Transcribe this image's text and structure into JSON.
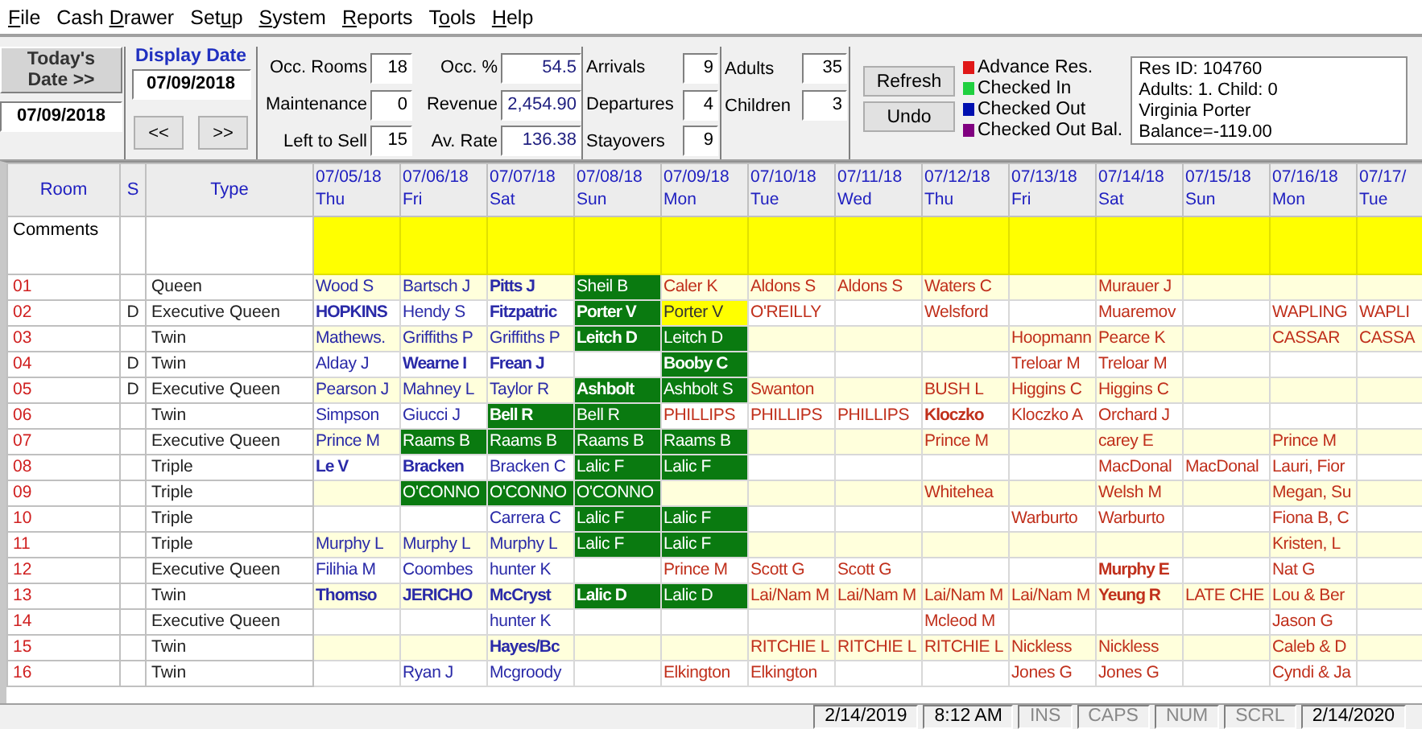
{
  "menu": [
    {
      "key": "F",
      "post": "ile"
    },
    {
      "pre": "Cash ",
      "key": "D",
      "post": "rawer"
    },
    {
      "pre": "Set",
      "key": "u",
      "post": "p"
    },
    {
      "key": "S",
      "post": "ystem"
    },
    {
      "key": "R",
      "post": "eports"
    },
    {
      "pre": "T",
      "key": "o",
      "post": "ols"
    },
    {
      "key": "H",
      "post": "elp"
    }
  ],
  "today": {
    "button": "Today's Date >>",
    "value": "07/09/2018"
  },
  "display_date": {
    "label": "Display Date",
    "value": "07/09/2018",
    "prev": "<<",
    "next": ">>"
  },
  "stat_groups": [
    [
      {
        "label": "Occ. Rooms",
        "value": "18"
      },
      {
        "label": "Maintenance",
        "value": "0"
      },
      {
        "label": "Left to Sell",
        "value": "15"
      }
    ],
    [
      {
        "label": "Occ. %",
        "value": "54.5"
      },
      {
        "label": "Revenue",
        "value": "2,454.90"
      },
      {
        "label": "Av. Rate",
        "value": "136.38"
      }
    ],
    [
      {
        "label": "Arrivals",
        "value": "9"
      },
      {
        "label": "Departures",
        "value": "4"
      },
      {
        "label": "Stayovers",
        "value": "9"
      }
    ],
    [
      {
        "label": "Adults",
        "value": "35"
      },
      {
        "label": "Children",
        "value": "3"
      }
    ]
  ],
  "buttons": [
    "Refresh",
    "Undo"
  ],
  "legend": [
    {
      "label": "Advance Res.",
      "color": "#e01818"
    },
    {
      "label": "Checked In",
      "color": "#20d040"
    },
    {
      "label": "Checked Out",
      "color": "#0010b0"
    },
    {
      "label": "Checked Out Bal.",
      "color": "#800080"
    }
  ],
  "res_info": [
    "Res ID: 104760",
    "Adults: 1. Child: 0",
    "Virginia Porter",
    "Balance=-119.00"
  ],
  "grid": {
    "room_header": "Room",
    "s_header": "S",
    "type_header": "Type",
    "comments_label": "Comments",
    "dates": [
      {
        "date": "07/05/18",
        "day": "Thu"
      },
      {
        "date": "07/06/18",
        "day": "Fri"
      },
      {
        "date": "07/07/18",
        "day": "Sat"
      },
      {
        "date": "07/08/18",
        "day": "Sun"
      },
      {
        "date": "07/09/18",
        "day": "Mon"
      },
      {
        "date": "07/10/18",
        "day": "Tue"
      },
      {
        "date": "07/11/18",
        "day": "Wed"
      },
      {
        "date": "07/12/18",
        "day": "Thu"
      },
      {
        "date": "07/13/18",
        "day": "Fri"
      },
      {
        "date": "07/14/18",
        "day": "Sat"
      },
      {
        "date": "07/15/18",
        "day": "Sun"
      },
      {
        "date": "07/16/18",
        "day": "Mon"
      },
      {
        "date": "07/17/",
        "day": "Tue"
      }
    ],
    "rows": [
      {
        "room": "01",
        "s": null,
        "type": "Queen",
        "cells": [
          {
            "text": "Wood S",
            "kind": "checked_out",
            "bold": false
          },
          {
            "text": "Bartsch J",
            "kind": "checked_out",
            "bold": false
          },
          {
            "text": "Pitts J",
            "kind": "checked_out",
            "bold": true
          },
          {
            "text": "Sheil B",
            "kind": "checked_in",
            "bold": false
          },
          {
            "text": "Caler K",
            "kind": "advance",
            "bold": false
          },
          {
            "text": "Aldons S",
            "kind": "advance",
            "bold": false
          },
          {
            "text": "Aldons S",
            "kind": "advance",
            "bold": false
          },
          {
            "text": "Waters C",
            "kind": "advance",
            "bold": false
          },
          null,
          {
            "text": "Murauer J",
            "kind": "advance",
            "bold": false
          },
          null,
          null,
          null
        ]
      },
      {
        "room": "02",
        "s": "D",
        "type": "Executive Queen",
        "cells": [
          {
            "text": "HOPKINS",
            "kind": "checked_out",
            "bold": true
          },
          {
            "text": "Hendy S",
            "kind": "checked_out",
            "bold": false
          },
          {
            "text": "Fitzpatric",
            "kind": "checked_out",
            "bold": true
          },
          {
            "text": "Porter V",
            "kind": "checked_in",
            "bold": true
          },
          {
            "text": "Porter V",
            "kind": "current",
            "bold": false
          },
          {
            "text": "O'REILLY",
            "kind": "advance",
            "bold": false
          },
          null,
          {
            "text": "Welsford",
            "kind": "advance",
            "bold": false
          },
          null,
          {
            "text": "Muaremov",
            "kind": "advance",
            "bold": false
          },
          null,
          {
            "text": "WAPLING",
            "kind": "advance",
            "bold": false
          },
          {
            "text": "WAPLI",
            "kind": "advance",
            "bold": false
          }
        ]
      },
      {
        "room": "03",
        "s": null,
        "type": "Twin",
        "cells": [
          {
            "text": "Mathews.",
            "kind": "checked_out",
            "bold": false
          },
          {
            "text": "Griffiths P",
            "kind": "checked_out",
            "bold": false
          },
          {
            "text": "Griffiths P",
            "kind": "checked_out",
            "bold": false
          },
          {
            "text": "Leitch D",
            "kind": "checked_in",
            "bold": true
          },
          {
            "text": "Leitch D",
            "kind": "checked_in",
            "bold": false
          },
          null,
          null,
          null,
          {
            "text": "Hoopmann",
            "kind": "advance",
            "bold": false
          },
          {
            "text": "Pearce K",
            "kind": "advance",
            "bold": false
          },
          null,
          {
            "text": "CASSAR",
            "kind": "advance",
            "bold": false
          },
          {
            "text": "CASSA",
            "kind": "advance",
            "bold": false
          }
        ]
      },
      {
        "room": "04",
        "s": "D",
        "type": "Twin",
        "cells": [
          {
            "text": "Alday J",
            "kind": "checked_out",
            "bold": false
          },
          {
            "text": "Wearne I",
            "kind": "checked_out",
            "bold": true
          },
          {
            "text": "Frean J",
            "kind": "checked_out",
            "bold": true
          },
          null,
          {
            "text": "Booby C",
            "kind": "checked_in",
            "bold": true
          },
          null,
          null,
          null,
          {
            "text": "Treloar M",
            "kind": "advance",
            "bold": false
          },
          {
            "text": "Treloar M",
            "kind": "advance",
            "bold": false
          },
          null,
          null,
          null
        ]
      },
      {
        "room": "05",
        "s": "D",
        "type": "Executive Queen",
        "cells": [
          {
            "text": "Pearson J",
            "kind": "checked_out",
            "bold": false
          },
          {
            "text": "Mahney L",
            "kind": "checked_out",
            "bold": false
          },
          {
            "text": "Taylor R",
            "kind": "checked_out",
            "bold": false
          },
          {
            "text": "Ashbolt",
            "kind": "checked_in",
            "bold": true
          },
          {
            "text": "Ashbolt S",
            "kind": "checked_in",
            "bold": false
          },
          {
            "text": "Swanton",
            "kind": "advance",
            "bold": false
          },
          null,
          {
            "text": "BUSH L",
            "kind": "advance",
            "bold": false
          },
          {
            "text": "Higgins C",
            "kind": "advance",
            "bold": false
          },
          {
            "text": "Higgins C",
            "kind": "advance",
            "bold": false
          },
          null,
          null,
          null
        ]
      },
      {
        "room": "06",
        "s": null,
        "type": "Twin",
        "cells": [
          {
            "text": "Simpson",
            "kind": "checked_out",
            "bold": false
          },
          {
            "text": "Giucci J",
            "kind": "checked_out",
            "bold": false
          },
          {
            "text": "Bell R",
            "kind": "checked_in",
            "bold": true
          },
          {
            "text": "Bell R",
            "kind": "checked_in",
            "bold": false
          },
          {
            "text": "PHILLIPS",
            "kind": "advance",
            "bold": false
          },
          {
            "text": "PHILLIPS",
            "kind": "advance",
            "bold": false
          },
          {
            "text": "PHILLIPS",
            "kind": "advance",
            "bold": false
          },
          {
            "text": "Kloczko",
            "kind": "advance",
            "bold": true
          },
          {
            "text": "Kloczko A",
            "kind": "advance",
            "bold": false
          },
          {
            "text": "Orchard J",
            "kind": "advance",
            "bold": false
          },
          null,
          null,
          null
        ]
      },
      {
        "room": "07",
        "s": null,
        "type": "Executive Queen",
        "cells": [
          {
            "text": "Prince M",
            "kind": "checked_out",
            "bold": false
          },
          {
            "text": "Raams B",
            "kind": "checked_in",
            "bold": false
          },
          {
            "text": "Raams B",
            "kind": "checked_in",
            "bold": false
          },
          {
            "text": "Raams B",
            "kind": "checked_in",
            "bold": false
          },
          {
            "text": "Raams B",
            "kind": "checked_in",
            "bold": false
          },
          null,
          null,
          {
            "text": "Prince M",
            "kind": "advance",
            "bold": false
          },
          null,
          {
            "text": "carey E",
            "kind": "advance",
            "bold": false
          },
          null,
          {
            "text": "Prince M",
            "kind": "advance",
            "bold": false
          },
          null
        ]
      },
      {
        "room": "08",
        "s": null,
        "type": "Triple",
        "cells": [
          {
            "text": "Le V",
            "kind": "checked_out",
            "bold": true
          },
          {
            "text": "Bracken",
            "kind": "checked_out",
            "bold": true
          },
          {
            "text": "Bracken C",
            "kind": "checked_out",
            "bold": false
          },
          {
            "text": "Lalic F",
            "kind": "checked_in",
            "bold": false
          },
          {
            "text": "Lalic F",
            "kind": "checked_in",
            "bold": false
          },
          null,
          null,
          null,
          null,
          {
            "text": "MacDonal",
            "kind": "advance",
            "bold": false
          },
          {
            "text": "MacDonal",
            "kind": "advance",
            "bold": false
          },
          {
            "text": "Lauri, Fior",
            "kind": "advance",
            "bold": false
          },
          null
        ]
      },
      {
        "room": "09",
        "s": null,
        "type": "Triple",
        "cells": [
          null,
          {
            "text": "O'CONNO",
            "kind": "checked_in",
            "bold": false
          },
          {
            "text": "O'CONNO",
            "kind": "checked_in",
            "bold": false
          },
          {
            "text": "O'CONNO",
            "kind": "checked_in",
            "bold": false
          },
          null,
          null,
          null,
          {
            "text": "Whitehea",
            "kind": "advance",
            "bold": false
          },
          null,
          {
            "text": "Welsh M",
            "kind": "advance",
            "bold": false
          },
          null,
          {
            "text": "Megan, Su",
            "kind": "advance",
            "bold": false
          },
          null
        ]
      },
      {
        "room": "10",
        "s": null,
        "type": "Triple",
        "cells": [
          null,
          null,
          {
            "text": "Carrera C",
            "kind": "checked_out",
            "bold": false
          },
          {
            "text": "Lalic F",
            "kind": "checked_in",
            "bold": false
          },
          {
            "text": "Lalic F",
            "kind": "checked_in",
            "bold": false
          },
          null,
          null,
          null,
          {
            "text": "Warburto",
            "kind": "advance",
            "bold": false
          },
          {
            "text": "Warburto",
            "kind": "advance",
            "bold": false
          },
          null,
          {
            "text": "Fiona B, C",
            "kind": "advance",
            "bold": false
          },
          null
        ]
      },
      {
        "room": "11",
        "s": null,
        "type": "Triple",
        "cells": [
          {
            "text": "Murphy L",
            "kind": "checked_out",
            "bold": false
          },
          {
            "text": "Murphy L",
            "kind": "checked_out",
            "bold": false
          },
          {
            "text": "Murphy L",
            "kind": "checked_out",
            "bold": false
          },
          {
            "text": "Lalic F",
            "kind": "checked_in",
            "bold": false
          },
          {
            "text": "Lalic F",
            "kind": "checked_in",
            "bold": false
          },
          null,
          null,
          null,
          null,
          null,
          null,
          {
            "text": "Kristen, L",
            "kind": "advance",
            "bold": false
          },
          null
        ]
      },
      {
        "room": "12",
        "s": null,
        "type": "Executive Queen",
        "cells": [
          {
            "text": "Filihia M",
            "kind": "checked_out",
            "bold": false
          },
          {
            "text": "Coombes",
            "kind": "checked_out",
            "bold": false
          },
          {
            "text": "hunter K",
            "kind": "checked_out",
            "bold": false
          },
          null,
          {
            "text": "Prince M",
            "kind": "advance",
            "bold": false
          },
          {
            "text": "Scott G",
            "kind": "advance",
            "bold": false
          },
          {
            "text": "Scott G",
            "kind": "advance",
            "bold": false
          },
          null,
          null,
          {
            "text": "Murphy E",
            "kind": "advance",
            "bold": true
          },
          null,
          {
            "text": "Nat G",
            "kind": "advance",
            "bold": false
          },
          null
        ]
      },
      {
        "room": "13",
        "s": null,
        "type": "Twin",
        "cells": [
          {
            "text": "Thomso",
            "kind": "checked_out",
            "bold": true
          },
          {
            "text": "JERICHO",
            "kind": "checked_out",
            "bold": true
          },
          {
            "text": "McCryst",
            "kind": "checked_out",
            "bold": true
          },
          {
            "text": "Lalic D",
            "kind": "checked_in",
            "bold": true
          },
          {
            "text": "Lalic D",
            "kind": "checked_in",
            "bold": false
          },
          {
            "text": "Lai/Nam M",
            "kind": "advance",
            "bold": false
          },
          {
            "text": "Lai/Nam M",
            "kind": "advance",
            "bold": false
          },
          {
            "text": "Lai/Nam M",
            "kind": "advance",
            "bold": false
          },
          {
            "text": "Lai/Nam M",
            "kind": "advance",
            "bold": false
          },
          {
            "text": "Yeung R",
            "kind": "advance",
            "bold": true
          },
          {
            "text": "LATE CHE",
            "kind": "advance",
            "bold": false
          },
          {
            "text": "Lou & Ber",
            "kind": "advance",
            "bold": false
          },
          null
        ]
      },
      {
        "room": "14",
        "s": null,
        "type": "Executive Queen",
        "cells": [
          null,
          null,
          {
            "text": "hunter K",
            "kind": "checked_out",
            "bold": false
          },
          null,
          null,
          null,
          null,
          {
            "text": "Mcleod M",
            "kind": "advance",
            "bold": false
          },
          null,
          null,
          null,
          {
            "text": "Jason G",
            "kind": "advance",
            "bold": false
          },
          null
        ]
      },
      {
        "room": "15",
        "s": null,
        "type": "Twin",
        "cells": [
          null,
          null,
          {
            "text": "Hayes/Bc",
            "kind": "checked_out",
            "bold": true
          },
          null,
          null,
          {
            "text": "RITCHIE L",
            "kind": "advance",
            "bold": false
          },
          {
            "text": "RITCHIE L",
            "kind": "advance",
            "bold": false
          },
          {
            "text": "RITCHIE L",
            "kind": "advance",
            "bold": false
          },
          {
            "text": "Nickless",
            "kind": "advance",
            "bold": false
          },
          {
            "text": "Nickless",
            "kind": "advance",
            "bold": false
          },
          null,
          {
            "text": "Caleb & D",
            "kind": "advance",
            "bold": false
          },
          null
        ]
      },
      {
        "room": "16",
        "s": null,
        "type": "Twin",
        "cells": [
          null,
          {
            "text": "Ryan J",
            "kind": "checked_out",
            "bold": false
          },
          {
            "text": "Mcgroody",
            "kind": "checked_out",
            "bold": false
          },
          null,
          {
            "text": "Elkington",
            "kind": "advance",
            "bold": false
          },
          {
            "text": "Elkington",
            "kind": "advance",
            "bold": false
          },
          null,
          null,
          {
            "text": "Jones G",
            "kind": "advance",
            "bold": false
          },
          {
            "text": "Jones G",
            "kind": "advance",
            "bold": false
          },
          null,
          {
            "text": "Cyndi & Ja",
            "kind": "advance",
            "bold": false
          },
          null
        ]
      }
    ]
  },
  "status_bar": [
    {
      "text": "2/14/2019",
      "disabled": false
    },
    {
      "text": "8:12 AM",
      "disabled": false
    },
    {
      "text": "INS",
      "disabled": true
    },
    {
      "text": "CAPS",
      "disabled": true
    },
    {
      "text": "NUM",
      "disabled": true
    },
    {
      "text": "SCRL",
      "disabled": true
    },
    {
      "text": "2/14/2020",
      "disabled": false
    }
  ]
}
